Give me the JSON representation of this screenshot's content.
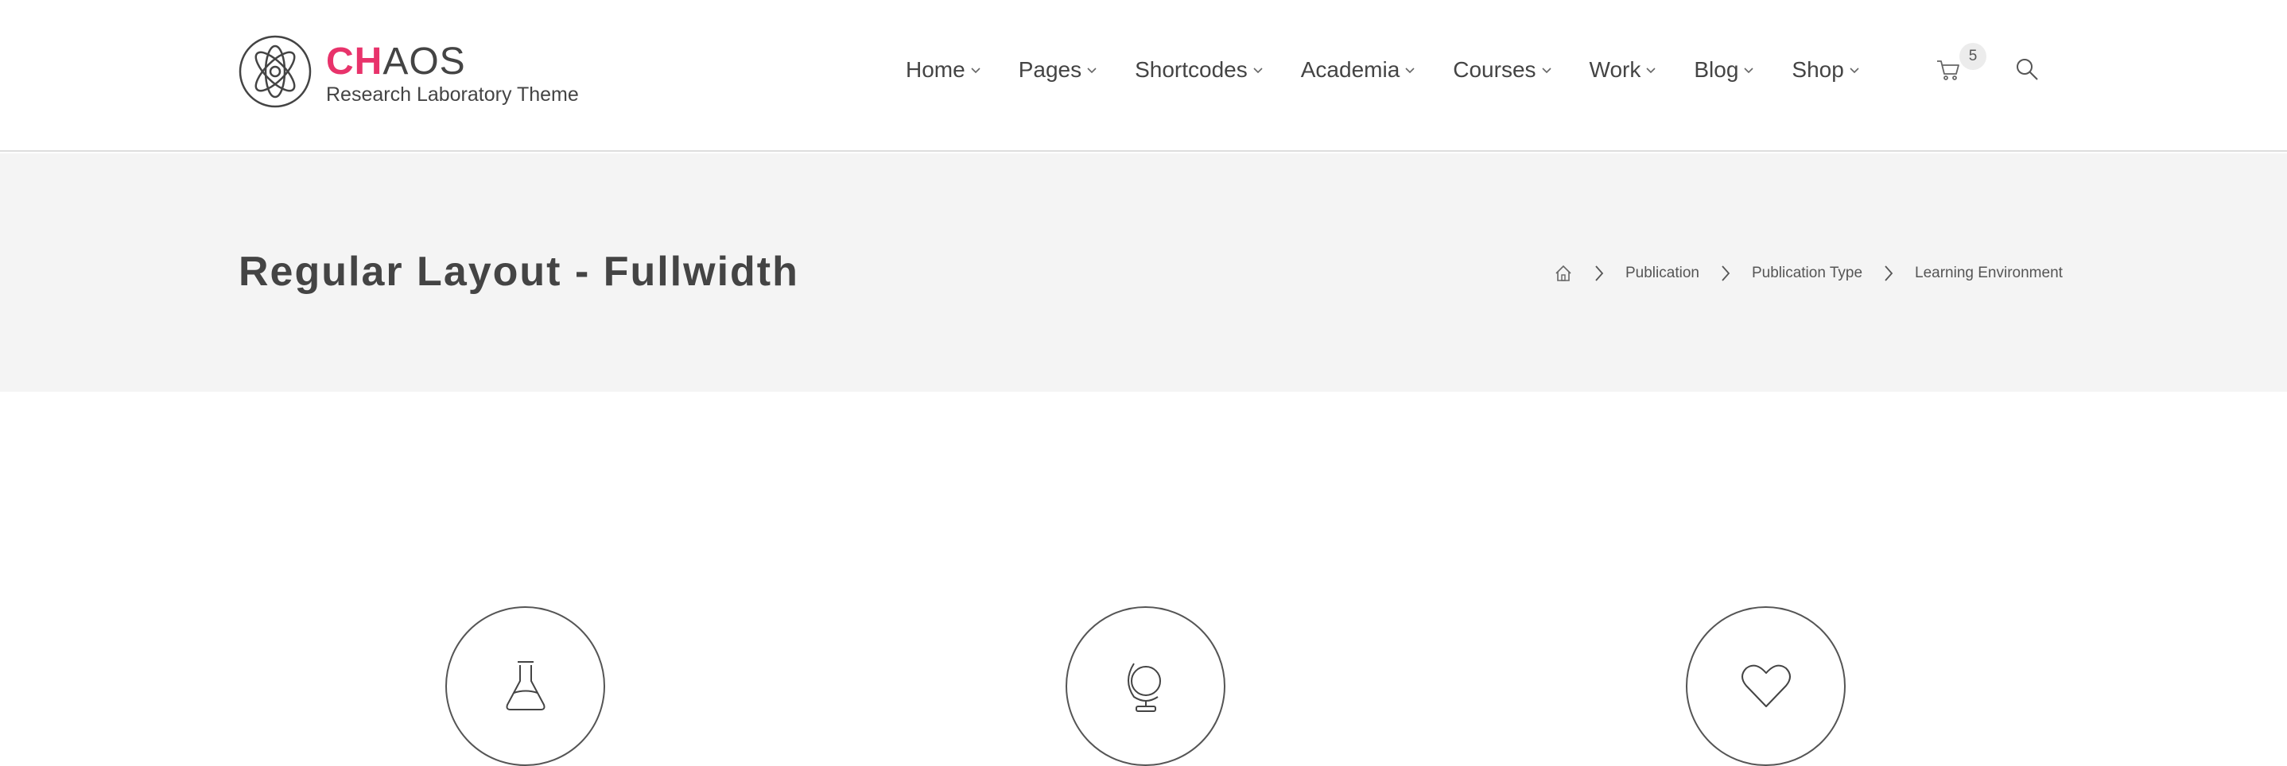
{
  "brand": {
    "name_accent": "CH",
    "name_rest": "AOS",
    "tagline": "Research Laboratory Theme",
    "accent_color": "#e8336b",
    "logo_icon": "atom-icon"
  },
  "nav": {
    "items": [
      {
        "label": "Home"
      },
      {
        "label": "Pages"
      },
      {
        "label": "Shortcodes"
      },
      {
        "label": "Academia"
      },
      {
        "label": "Courses"
      },
      {
        "label": "Work"
      },
      {
        "label": "Blog"
      },
      {
        "label": "Shop"
      }
    ],
    "cart_icon": "cart-icon",
    "cart_count": "5",
    "search_icon": "search-icon"
  },
  "page": {
    "title": "Regular Layout - Fullwidth"
  },
  "breadcrumb": {
    "home_icon": "home-icon",
    "items": [
      {
        "label": "Publication"
      },
      {
        "label": "Publication Type"
      },
      {
        "label": "Learning Environment"
      }
    ]
  },
  "features": [
    {
      "icon": "flask-icon"
    },
    {
      "icon": "globe-icon"
    },
    {
      "icon": "heart-icon"
    }
  ]
}
